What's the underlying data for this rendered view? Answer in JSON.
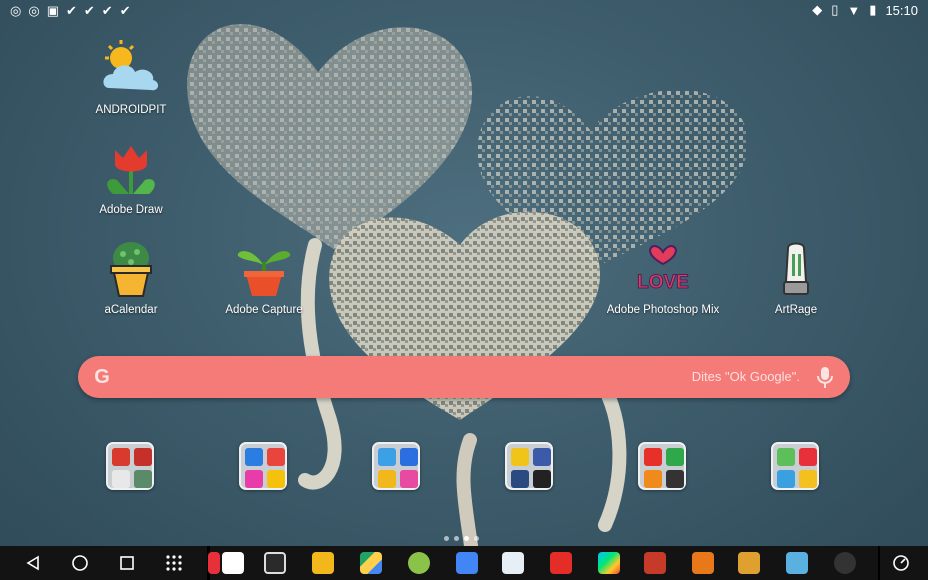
{
  "status_bar": {
    "left_icons": [
      "chrome-icon",
      "chrome-icon",
      "image-icon",
      "check-icon",
      "check-icon",
      "check-icon",
      "check-icon"
    ],
    "time": "15:10"
  },
  "desktop": {
    "apps": [
      {
        "name": "androidpit",
        "label": "ANDROIDPIT"
      },
      {
        "name": "adobe-draw",
        "label": "Adobe Draw"
      },
      {
        "name": "acalendar",
        "label": "aCalendar"
      },
      {
        "name": "adobe-capture",
        "label": "Adobe Capture"
      },
      {
        "name": "adobe-photoshop-mix",
        "label": "Adobe Photoshop Mix"
      },
      {
        "name": "artrage",
        "label": "ArtRage"
      }
    ],
    "love_text": "LOVE"
  },
  "search": {
    "placeholder": "Dites \"Ok Google\".",
    "logo": "G"
  },
  "folders": 6,
  "page_indicator": {
    "pages": 4,
    "current": 3
  },
  "taskbar": {
    "nav": [
      "back-icon",
      "home-icon",
      "recents-icon",
      "app-drawer-icon"
    ],
    "pinned_apps": [
      "pocket",
      "tablet",
      "settings-gear",
      "drive",
      "settings",
      "calendar",
      "reader",
      "youtube",
      "play-store",
      "game-1",
      "game-2",
      "game-3",
      "game-4",
      "share"
    ]
  },
  "colors": {
    "search_bar": "#f47b78",
    "taskbar": "#131313"
  }
}
